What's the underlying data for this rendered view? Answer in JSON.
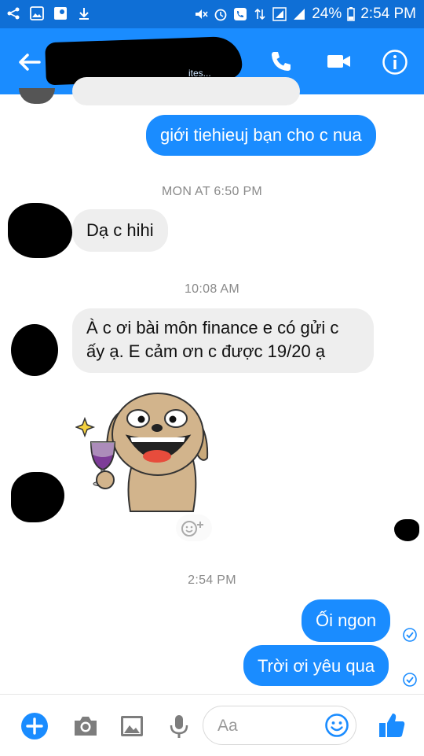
{
  "status_bar": {
    "battery": "24%",
    "time": "2:54 PM"
  },
  "header": {
    "subtitle": "ites..."
  },
  "messages": {
    "m1": "giới tiehieuj bạn cho c nua",
    "ts1": "MON AT 6:50 PM",
    "m2": "Dạ  c hihi",
    "ts2": "10:08 AM",
    "m3_line1": "À c ơi bài môn finance e có gửi c",
    "m3_line2": "ấy ạ. E cảm ơn c được 19/20 ạ",
    "ts3": "2:54 PM",
    "m4": "Ối ngon",
    "m5": "Trời ơi yêu qua"
  },
  "composer": {
    "placeholder": "Aa"
  },
  "colors": {
    "brand": "#1a8cff",
    "status_bar": "#0f6fd6",
    "incoming_bubble": "#eeeeee"
  },
  "icons": [
    "back-arrow-icon",
    "phone-icon",
    "video-icon",
    "info-icon",
    "plus-icon",
    "camera-icon",
    "image-icon",
    "mic-icon",
    "emoji-icon",
    "like-icon",
    "seen-check-icon",
    "add-reaction-icon"
  ]
}
